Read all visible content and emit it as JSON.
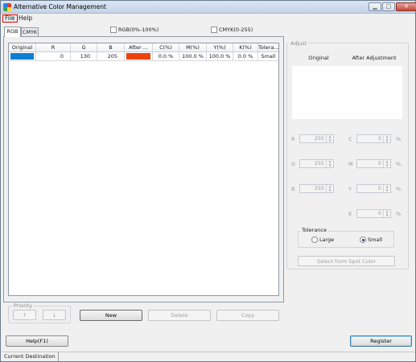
{
  "window": {
    "title": "Alternative Color Management",
    "controls": {
      "minimize": "▁",
      "maximize": "▢",
      "close": "✕"
    },
    "icon": "app-color-icon"
  },
  "menu": {
    "file": "File",
    "help": "Help"
  },
  "tabs": [
    {
      "label": "RGB",
      "active": true
    },
    {
      "label": "CMYK",
      "active": false
    }
  ],
  "options": {
    "rgb_percent": "RGB(0%-100%)",
    "cmyk_range": "CMYK(0-255)"
  },
  "table": {
    "headers": [
      "Original",
      "R",
      "G",
      "B",
      "After ...",
      "C(%)",
      "M(%)",
      "Y(%)",
      "K(%)",
      "Tolera..."
    ],
    "rows": [
      {
        "original_color": "#0e7fd2",
        "r": "0",
        "g": "130",
        "b": "205",
        "after_color": "#f0420c",
        "c": "0.0 %",
        "m": "100.0 %",
        "y": "100.0 %",
        "k": "0.0 %",
        "tolerance": "Small"
      }
    ]
  },
  "priority": {
    "legend": "Priority",
    "up": "↑",
    "down": "↓"
  },
  "actions": {
    "new": "New",
    "delete": "Delete",
    "copy": "Copy"
  },
  "adjust": {
    "legend": "Adjust",
    "original_label": "Original",
    "after_label": "After Adjustment",
    "rgb_fields": [
      {
        "label": "R",
        "value": "255"
      },
      {
        "label": "G",
        "value": "255"
      },
      {
        "label": "B",
        "value": "255"
      }
    ],
    "cmyk_fields": [
      {
        "label": "C",
        "value": "0",
        "unit": "%"
      },
      {
        "label": "M",
        "value": "0",
        "unit": "%"
      },
      {
        "label": "Y",
        "value": "0",
        "unit": "%"
      },
      {
        "label": "K",
        "value": "0",
        "unit": "%"
      }
    ],
    "tolerance_legend": "Tolerance",
    "tolerance_large": "Large",
    "tolerance_small": "Small",
    "tolerance_selected": "Small",
    "spot_button": "Select from Spot Color"
  },
  "footer": {
    "help": "Help(F1)",
    "register": "Register"
  },
  "status": {
    "destination": "Current Destination"
  }
}
